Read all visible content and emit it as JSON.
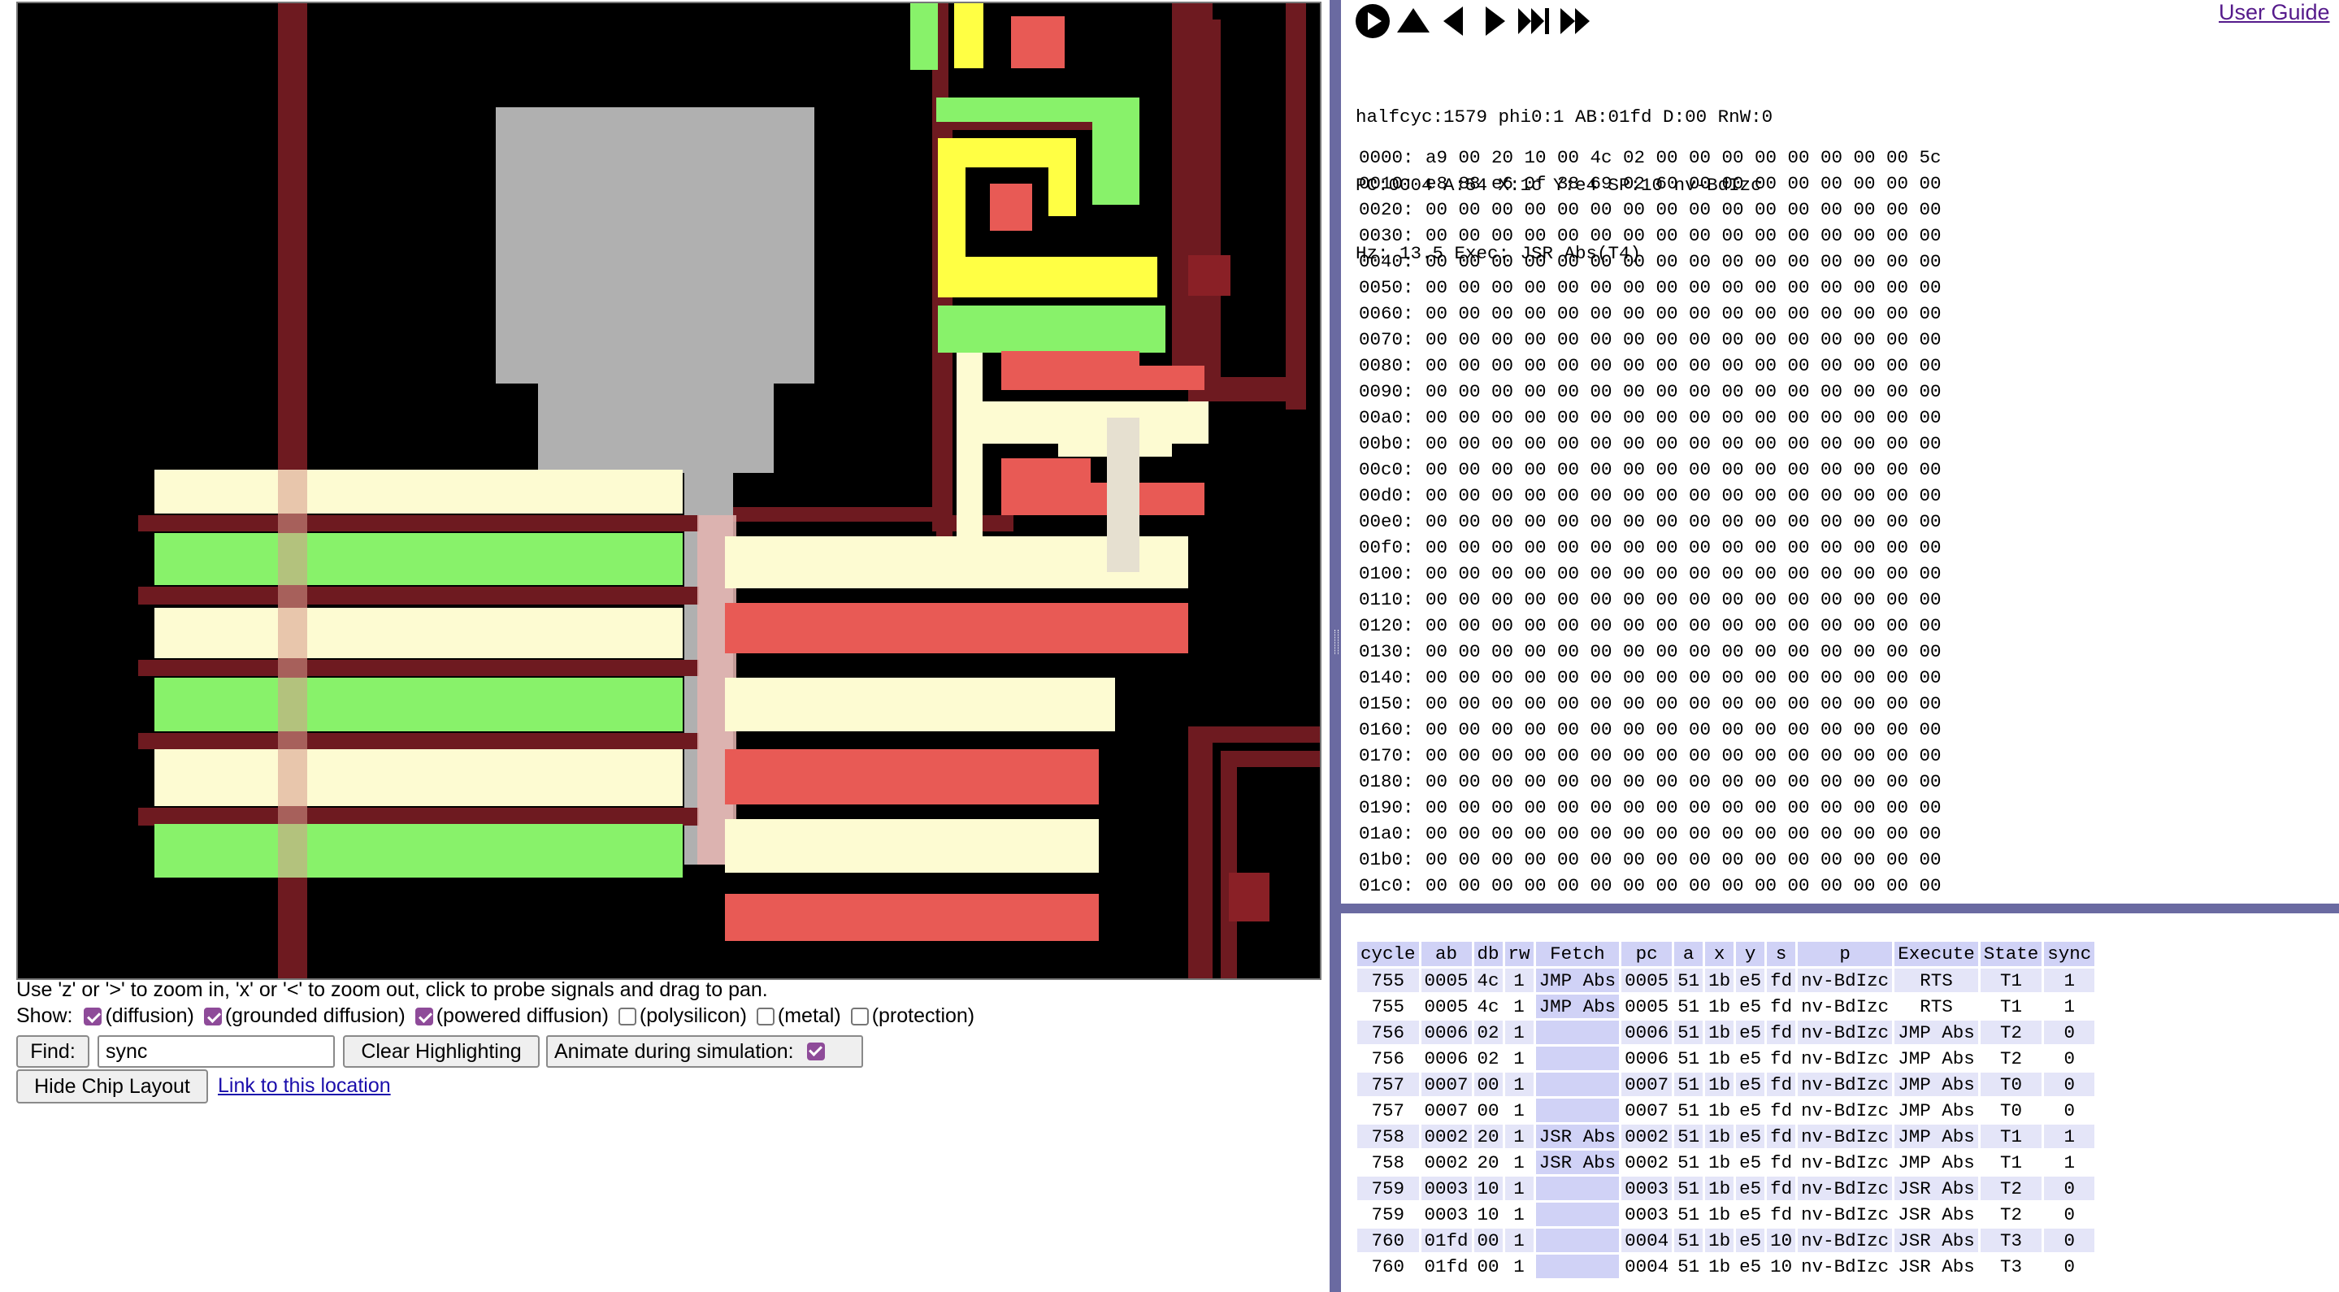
{
  "chip": {
    "help_text": "Use 'z' or '>' to zoom in, 'x' or '<' to zoom out, click to probe signals and drag to pan.",
    "show_label": "Show:",
    "layers": [
      {
        "label": "(diffusion)",
        "checked": true
      },
      {
        "label": "(grounded diffusion)",
        "checked": true
      },
      {
        "label": "(powered diffusion)",
        "checked": true
      },
      {
        "label": "(polysilicon)",
        "checked": false
      },
      {
        "label": "(metal)",
        "checked": false
      },
      {
        "label": "(protection)",
        "checked": false
      }
    ],
    "find_label": "Find:",
    "find_value": "sync",
    "clear_label": "Clear Highlighting",
    "animate_label": "Animate during simulation:",
    "animate_checked": true,
    "hide_label": "Hide Chip Layout",
    "link_label": "Link to this location",
    "colors": {
      "background": "#000000",
      "metal_dark": "#6e1a20",
      "grounded": "#88f26a",
      "powered": "#e85a55",
      "highlight": "#fdfbd2",
      "gate": "#ffff44",
      "probe_gray": "#b0b0b0"
    }
  },
  "controls": {
    "buttons": [
      "play-icon",
      "step-up-icon",
      "step-back-icon",
      "step-forward-icon",
      "fast-forward-end-icon",
      "fast-forward-icon"
    ],
    "user_guide": "User Guide"
  },
  "status": {
    "line1": "halfcyc:1579 phi0:1 AB:01fd D:00 RnW:0",
    "line2": "PC:0004 A:54 X:1c Y:e4 SP:10 nv-BdIzc",
    "line3": "Hz: 13.5 Exec: JSR Abs(T4)"
  },
  "memory": [
    {
      "addr": "0000:",
      "bytes": [
        "a9",
        "00",
        "20",
        "10",
        "00",
        "4c",
        "02",
        "00",
        "00",
        "00",
        "00",
        "00",
        "00",
        "00",
        "00",
        "5c"
      ]
    },
    {
      "addr": "0010:",
      "bytes": [
        "e8",
        "88",
        "e6",
        "0f",
        "38",
        "69",
        "02",
        "60",
        "00",
        "00",
        "00",
        "00",
        "00",
        "00",
        "00",
        "00"
      ]
    },
    {
      "addr": "0020:",
      "bytes": [
        "00",
        "00",
        "00",
        "00",
        "00",
        "00",
        "00",
        "00",
        "00",
        "00",
        "00",
        "00",
        "00",
        "00",
        "00",
        "00"
      ]
    },
    {
      "addr": "0030:",
      "bytes": [
        "00",
        "00",
        "00",
        "00",
        "00",
        "00",
        "00",
        "00",
        "00",
        "00",
        "00",
        "00",
        "00",
        "00",
        "00",
        "00"
      ]
    },
    {
      "addr": "0040:",
      "bytes": [
        "00",
        "00",
        "00",
        "00",
        "00",
        "00",
        "00",
        "00",
        "00",
        "00",
        "00",
        "00",
        "00",
        "00",
        "00",
        "00"
      ]
    },
    {
      "addr": "0050:",
      "bytes": [
        "00",
        "00",
        "00",
        "00",
        "00",
        "00",
        "00",
        "00",
        "00",
        "00",
        "00",
        "00",
        "00",
        "00",
        "00",
        "00"
      ]
    },
    {
      "addr": "0060:",
      "bytes": [
        "00",
        "00",
        "00",
        "00",
        "00",
        "00",
        "00",
        "00",
        "00",
        "00",
        "00",
        "00",
        "00",
        "00",
        "00",
        "00"
      ]
    },
    {
      "addr": "0070:",
      "bytes": [
        "00",
        "00",
        "00",
        "00",
        "00",
        "00",
        "00",
        "00",
        "00",
        "00",
        "00",
        "00",
        "00",
        "00",
        "00",
        "00"
      ]
    },
    {
      "addr": "0080:",
      "bytes": [
        "00",
        "00",
        "00",
        "00",
        "00",
        "00",
        "00",
        "00",
        "00",
        "00",
        "00",
        "00",
        "00",
        "00",
        "00",
        "00"
      ]
    },
    {
      "addr": "0090:",
      "bytes": [
        "00",
        "00",
        "00",
        "00",
        "00",
        "00",
        "00",
        "00",
        "00",
        "00",
        "00",
        "00",
        "00",
        "00",
        "00",
        "00"
      ]
    },
    {
      "addr": "00a0:",
      "bytes": [
        "00",
        "00",
        "00",
        "00",
        "00",
        "00",
        "00",
        "00",
        "00",
        "00",
        "00",
        "00",
        "00",
        "00",
        "00",
        "00"
      ]
    },
    {
      "addr": "00b0:",
      "bytes": [
        "00",
        "00",
        "00",
        "00",
        "00",
        "00",
        "00",
        "00",
        "00",
        "00",
        "00",
        "00",
        "00",
        "00",
        "00",
        "00"
      ]
    },
    {
      "addr": "00c0:",
      "bytes": [
        "00",
        "00",
        "00",
        "00",
        "00",
        "00",
        "00",
        "00",
        "00",
        "00",
        "00",
        "00",
        "00",
        "00",
        "00",
        "00"
      ]
    },
    {
      "addr": "00d0:",
      "bytes": [
        "00",
        "00",
        "00",
        "00",
        "00",
        "00",
        "00",
        "00",
        "00",
        "00",
        "00",
        "00",
        "00",
        "00",
        "00",
        "00"
      ]
    },
    {
      "addr": "00e0:",
      "bytes": [
        "00",
        "00",
        "00",
        "00",
        "00",
        "00",
        "00",
        "00",
        "00",
        "00",
        "00",
        "00",
        "00",
        "00",
        "00",
        "00"
      ]
    },
    {
      "addr": "00f0:",
      "bytes": [
        "00",
        "00",
        "00",
        "00",
        "00",
        "00",
        "00",
        "00",
        "00",
        "00",
        "00",
        "00",
        "00",
        "00",
        "00",
        "00"
      ]
    },
    {
      "addr": "0100:",
      "bytes": [
        "00",
        "00",
        "00",
        "00",
        "00",
        "00",
        "00",
        "00",
        "00",
        "00",
        "00",
        "00",
        "00",
        "00",
        "00",
        "00"
      ]
    },
    {
      "addr": "0110:",
      "bytes": [
        "00",
        "00",
        "00",
        "00",
        "00",
        "00",
        "00",
        "00",
        "00",
        "00",
        "00",
        "00",
        "00",
        "00",
        "00",
        "00"
      ]
    },
    {
      "addr": "0120:",
      "bytes": [
        "00",
        "00",
        "00",
        "00",
        "00",
        "00",
        "00",
        "00",
        "00",
        "00",
        "00",
        "00",
        "00",
        "00",
        "00",
        "00"
      ]
    },
    {
      "addr": "0130:",
      "bytes": [
        "00",
        "00",
        "00",
        "00",
        "00",
        "00",
        "00",
        "00",
        "00",
        "00",
        "00",
        "00",
        "00",
        "00",
        "00",
        "00"
      ]
    },
    {
      "addr": "0140:",
      "bytes": [
        "00",
        "00",
        "00",
        "00",
        "00",
        "00",
        "00",
        "00",
        "00",
        "00",
        "00",
        "00",
        "00",
        "00",
        "00",
        "00"
      ]
    },
    {
      "addr": "0150:",
      "bytes": [
        "00",
        "00",
        "00",
        "00",
        "00",
        "00",
        "00",
        "00",
        "00",
        "00",
        "00",
        "00",
        "00",
        "00",
        "00",
        "00"
      ]
    },
    {
      "addr": "0160:",
      "bytes": [
        "00",
        "00",
        "00",
        "00",
        "00",
        "00",
        "00",
        "00",
        "00",
        "00",
        "00",
        "00",
        "00",
        "00",
        "00",
        "00"
      ]
    },
    {
      "addr": "0170:",
      "bytes": [
        "00",
        "00",
        "00",
        "00",
        "00",
        "00",
        "00",
        "00",
        "00",
        "00",
        "00",
        "00",
        "00",
        "00",
        "00",
        "00"
      ]
    },
    {
      "addr": "0180:",
      "bytes": [
        "00",
        "00",
        "00",
        "00",
        "00",
        "00",
        "00",
        "00",
        "00",
        "00",
        "00",
        "00",
        "00",
        "00",
        "00",
        "00"
      ]
    },
    {
      "addr": "0190:",
      "bytes": [
        "00",
        "00",
        "00",
        "00",
        "00",
        "00",
        "00",
        "00",
        "00",
        "00",
        "00",
        "00",
        "00",
        "00",
        "00",
        "00"
      ]
    },
    {
      "addr": "01a0:",
      "bytes": [
        "00",
        "00",
        "00",
        "00",
        "00",
        "00",
        "00",
        "00",
        "00",
        "00",
        "00",
        "00",
        "00",
        "00",
        "00",
        "00"
      ]
    },
    {
      "addr": "01b0:",
      "bytes": [
        "00",
        "00",
        "00",
        "00",
        "00",
        "00",
        "00",
        "00",
        "00",
        "00",
        "00",
        "00",
        "00",
        "00",
        "00",
        "00"
      ]
    },
    {
      "addr": "01c0:",
      "bytes": [
        "00",
        "00",
        "00",
        "00",
        "00",
        "00",
        "00",
        "00",
        "00",
        "00",
        "00",
        "00",
        "00",
        "00",
        "00",
        "00"
      ]
    }
  ],
  "trace": {
    "headers": [
      "cycle",
      "ab",
      "db",
      "rw",
      "Fetch",
      "pc",
      "a",
      "x",
      "y",
      "s",
      "p",
      "Execute",
      "State",
      "sync"
    ],
    "rows": [
      [
        "755",
        "0005",
        "4c",
        "1",
        "JMP Abs",
        "0005",
        "51",
        "1b",
        "e5",
        "fd",
        "nv-BdIzc",
        "RTS",
        "T1",
        "1"
      ],
      [
        "755",
        "0005",
        "4c",
        "1",
        "JMP Abs",
        "0005",
        "51",
        "1b",
        "e5",
        "fd",
        "nv-BdIzc",
        "RTS",
        "T1",
        "1"
      ],
      [
        "756",
        "0006",
        "02",
        "1",
        "",
        "0006",
        "51",
        "1b",
        "e5",
        "fd",
        "nv-BdIzc",
        "JMP Abs",
        "T2",
        "0"
      ],
      [
        "756",
        "0006",
        "02",
        "1",
        "",
        "0006",
        "51",
        "1b",
        "e5",
        "fd",
        "nv-BdIzc",
        "JMP Abs",
        "T2",
        "0"
      ],
      [
        "757",
        "0007",
        "00",
        "1",
        "",
        "0007",
        "51",
        "1b",
        "e5",
        "fd",
        "nv-BdIzc",
        "JMP Abs",
        "T0",
        "0"
      ],
      [
        "757",
        "0007",
        "00",
        "1",
        "",
        "0007",
        "51",
        "1b",
        "e5",
        "fd",
        "nv-BdIzc",
        "JMP Abs",
        "T0",
        "0"
      ],
      [
        "758",
        "0002",
        "20",
        "1",
        "JSR Abs",
        "0002",
        "51",
        "1b",
        "e5",
        "fd",
        "nv-BdIzc",
        "JMP Abs",
        "T1",
        "1"
      ],
      [
        "758",
        "0002",
        "20",
        "1",
        "JSR Abs",
        "0002",
        "51",
        "1b",
        "e5",
        "fd",
        "nv-BdIzc",
        "JMP Abs",
        "T1",
        "1"
      ],
      [
        "759",
        "0003",
        "10",
        "1",
        "",
        "0003",
        "51",
        "1b",
        "e5",
        "fd",
        "nv-BdIzc",
        "JSR Abs",
        "T2",
        "0"
      ],
      [
        "759",
        "0003",
        "10",
        "1",
        "",
        "0003",
        "51",
        "1b",
        "e5",
        "fd",
        "nv-BdIzc",
        "JSR Abs",
        "T2",
        "0"
      ],
      [
        "760",
        "01fd",
        "00",
        "1",
        "",
        "0004",
        "51",
        "1b",
        "e5",
        "10",
        "nv-BdIzc",
        "JSR Abs",
        "T3",
        "0"
      ],
      [
        "760",
        "01fd",
        "00",
        "1",
        "",
        "0004",
        "51",
        "1b",
        "e5",
        "10",
        "nv-BdIzc",
        "JSR Abs",
        "T3",
        "0"
      ]
    ]
  }
}
